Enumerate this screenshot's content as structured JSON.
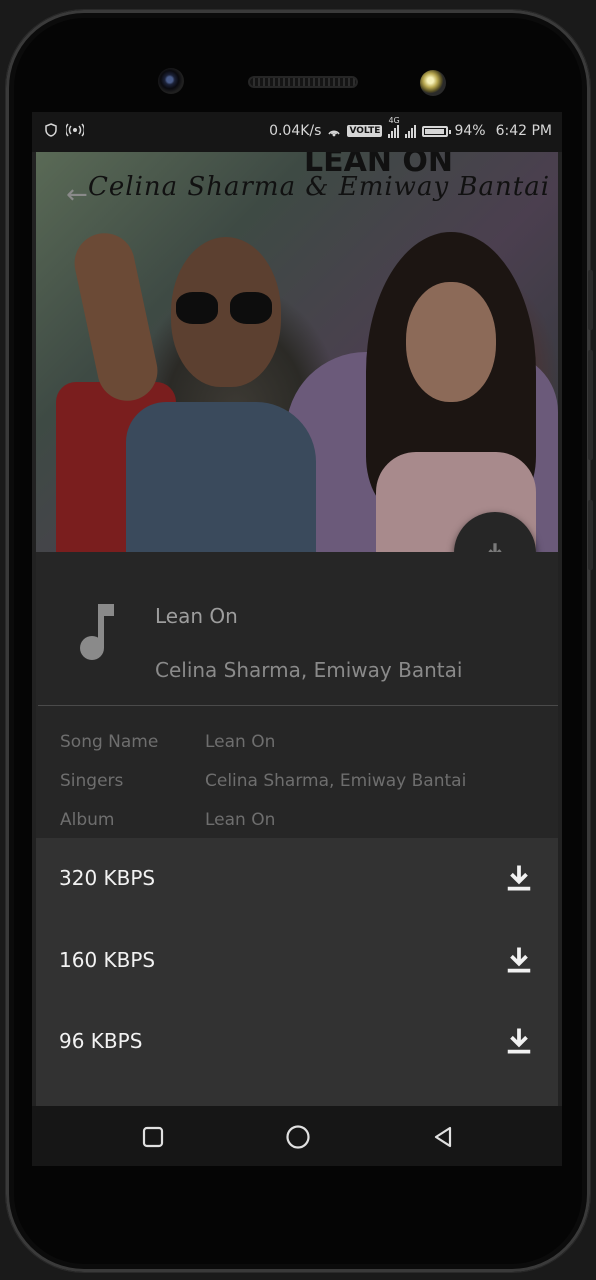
{
  "status_bar": {
    "net_speed": "0.04K/s",
    "volte": "VOLTE",
    "network": "4G",
    "battery": "94%",
    "battery_level": 0.94,
    "time": "6:42 PM"
  },
  "cover_art": {
    "title_text": "LEAN ON",
    "artist_text": "Celina Sharma & Emiway Bantai"
  },
  "song": {
    "title": "Lean On",
    "artists": "Celina Sharma, Emiway Bantai"
  },
  "details": [
    {
      "key": "Song Name",
      "value": "Lean On"
    },
    {
      "key": "Singers",
      "value": "Celina Sharma, Emiway Bantai"
    },
    {
      "key": "Album",
      "value": "Lean On"
    }
  ],
  "download_options": [
    {
      "label": "320 KBPS"
    },
    {
      "label": "160 KBPS"
    },
    {
      "label": "96 KBPS"
    }
  ],
  "icons": {
    "back": "back-arrow-icon",
    "fab": "download-icon",
    "note": "music-note-icon",
    "nav": [
      "recents-square-icon",
      "home-circle-icon",
      "back-triangle-icon"
    ]
  }
}
